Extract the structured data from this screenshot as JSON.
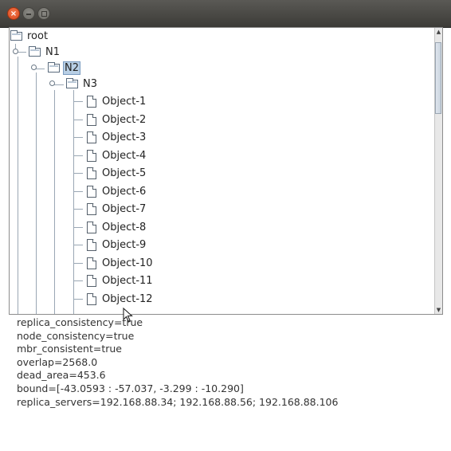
{
  "window": {
    "close_glyph": "×"
  },
  "tree": {
    "root": {
      "label": "root"
    },
    "n1": {
      "label": "N1"
    },
    "n2": {
      "label": "N2",
      "selected": true
    },
    "n3": {
      "label": "N3"
    },
    "objects": [
      "Object-1",
      "Object-2",
      "Object-3",
      "Object-4",
      "Object-5",
      "Object-6",
      "Object-7",
      "Object-8",
      "Object-9",
      "Object-10",
      "Object-11",
      "Object-12"
    ]
  },
  "scrollbar": {
    "up_glyph": "▲",
    "down_glyph": "▼"
  },
  "info": {
    "replica_consistency": "replica_consistency=true",
    "node_consistency": "node_consistency=true",
    "mbr_consistent": "mbr_consistent=true",
    "overlap": "overlap=2568.0",
    "dead_area": "dead_area=453.6",
    "bound": "bound=[-43.0593 : -57.037, -3.299 : -10.290]",
    "replica_servers": "replica_servers=192.168.88.34; 192.168.88.56; 192.168.88.106"
  },
  "colors": {
    "selection": "#b8cfe5",
    "close_button": "#e3521f",
    "titlebar": "#3c3b37"
  }
}
